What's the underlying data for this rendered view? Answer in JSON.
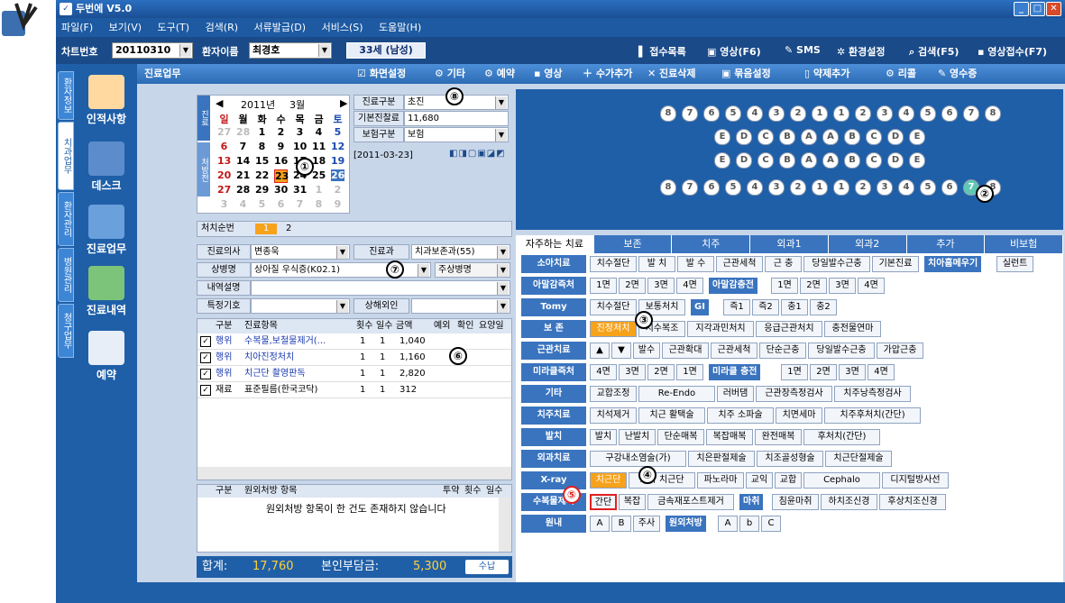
{
  "window": {
    "title": "두번에 V5.0"
  },
  "menu": [
    "파일(F)",
    "보기(V)",
    "도구(T)",
    "검색(R)",
    "서류발급(D)",
    "서비스(S)",
    "도움말(H)"
  ],
  "toolbar": {
    "chart_label": "차트번호",
    "chart_no": "20110310",
    "patient_label": "환자이름",
    "patient_name": "최경호",
    "age": "33세 (남성)",
    "right": [
      "접수목록",
      "영상(F6)",
      "SMS",
      "환경설정",
      "검색(F5)",
      "영상접수(F7)"
    ]
  },
  "nav": {
    "vtabs": [
      "환자정보",
      "치과업무",
      "환자관리",
      "병원관리",
      "청구업무"
    ],
    "items": [
      "인적사항",
      "데스크",
      "진료업무",
      "진료내역",
      "예약"
    ]
  },
  "main": {
    "title": "진료업무",
    "actions": [
      "화면설정",
      "기타",
      "예약",
      "영상",
      "수가추가",
      "진료삭제",
      "묶음설정",
      "약제추가",
      "리콜",
      "영수증"
    ]
  },
  "calendar": {
    "year": "2011년",
    "month": "3월",
    "weekdays": [
      "일",
      "월",
      "화",
      "수",
      "목",
      "금",
      "토"
    ],
    "rows": [
      [
        "27",
        "28",
        "1",
        "2",
        "3",
        "4",
        "5"
      ],
      [
        "6",
        "7",
        "8",
        "9",
        "10",
        "11",
        "12"
      ],
      [
        "13",
        "14",
        "15",
        "16",
        "17",
        "18",
        "19"
      ],
      [
        "20",
        "21",
        "22",
        "23",
        "24",
        "25",
        "26"
      ],
      [
        "27",
        "28",
        "29",
        "30",
        "31",
        "1",
        "2"
      ],
      [
        "3",
        "4",
        "5",
        "6",
        "7",
        "8",
        "9"
      ]
    ],
    "side1": "진료",
    "side2": "처방전"
  },
  "info": {
    "gubun_label": "진료구분",
    "gubun": "초진",
    "base_label": "기본진찰료",
    "base": "11,680",
    "ins_label": "보험구분",
    "ins": "보험",
    "date": "[2011-03-23]"
  },
  "order": {
    "label": "처치순번",
    "n1": "1",
    "n2": "2"
  },
  "form": {
    "doctor_label": "진료의사",
    "doctor": "변종욱",
    "dept_label": "진료과",
    "dept": "치과보존과(55)",
    "disease_label": "상병명",
    "disease": "상아질 우식증(K02.1)",
    "main_disease": "주상병명",
    "desc_label": "내역설명",
    "special_label": "특정기호",
    "sang_label": "상해외인"
  },
  "grid": {
    "headers": [
      "구분",
      "진료항목",
      "횟수",
      "일수",
      "금액",
      "예외",
      "확인",
      "요양일"
    ],
    "rows": [
      {
        "type": "행위",
        "item": "수복물,보철물제거(...",
        "cnt": "1",
        "days": "1",
        "amt": "1,040"
      },
      {
        "type": "행위",
        "item": "치아진정처치",
        "cnt": "1",
        "days": "1",
        "amt": "1,160"
      },
      {
        "type": "행위",
        "item": "치근단 촬영판독",
        "cnt": "1",
        "days": "1",
        "amt": "2,820"
      },
      {
        "type": "재료",
        "item": "표준필름(한국코닥)",
        "cnt": "1",
        "days": "1",
        "amt": "312"
      }
    ]
  },
  "rx": {
    "headers": [
      "구분",
      "원외처방 항목",
      "투약",
      "횟수",
      "일수"
    ],
    "empty": "원외처방 항목이 한 건도 존재하지 않습니다"
  },
  "totals": {
    "sum_label": "합계:",
    "sum": "17,760",
    "self_label": "본인부담금:",
    "self": "5,300",
    "pay": "수납"
  },
  "teeth": {
    "upper_perm": [
      "8",
      "7",
      "6",
      "5",
      "4",
      "3",
      "2",
      "1",
      "1",
      "2",
      "3",
      "4",
      "5",
      "6",
      "7",
      "8"
    ],
    "upper_prim": [
      "E",
      "D",
      "C",
      "B",
      "A",
      "A",
      "B",
      "C",
      "D",
      "E"
    ],
    "lower_prim": [
      "E",
      "D",
      "C",
      "B",
      "A",
      "A",
      "B",
      "C",
      "D",
      "E"
    ],
    "lower_perm": [
      "8",
      "7",
      "6",
      "5",
      "4",
      "3",
      "2",
      "1",
      "1",
      "2",
      "3",
      "4",
      "5",
      "6",
      "7",
      "8"
    ]
  },
  "tabs": [
    "자주하는 치료",
    "보존",
    "치주",
    "외과1",
    "외과2",
    "추가",
    "비보험"
  ],
  "treatments": [
    {
      "cat": "소아치료",
      "items": [
        "치수절단",
        "발 치",
        "발 수",
        "근관세척",
        "근 충",
        "당일발수근충",
        "기본진료"
      ],
      "sub": "치아홈메우기",
      "sub_items": [
        "실런트"
      ]
    },
    {
      "cat": "아말감즉처",
      "items": [
        "1면",
        "2면",
        "3면",
        "4면"
      ],
      "sub": "아말감충전",
      "sub_items": [
        "1면",
        "2면",
        "3면",
        "4면"
      ]
    },
    {
      "cat": "Tomy",
      "items": [
        "치수절단",
        "보통처치"
      ],
      "sub": "GI",
      "sub_items": [
        "즉1",
        "즉2",
        "충1",
        "충2"
      ]
    },
    {
      "cat": "보 존",
      "items": [
        "진정처치",
        "치수복조",
        "지각과민처치",
        "응급근관처치",
        "충전물연마"
      ]
    },
    {
      "cat": "근관치료",
      "items": [
        "▲",
        "▼",
        "발수",
        "근관확대",
        "근관세척",
        "단순근충",
        "당일발수근충",
        "가압근충"
      ]
    },
    {
      "cat": "미라클즉처",
      "items": [
        "4면",
        "3면",
        "2면",
        "1면"
      ],
      "sub": "미라클 충전",
      "sub_items": [
        "1면",
        "2면",
        "3면",
        "4면"
      ]
    },
    {
      "cat": "기타",
      "items": [
        "교합조정",
        "Re-Endo",
        "러버댐",
        "근관장측정검사",
        "치주낭측정검사"
      ]
    },
    {
      "cat": "치주치료",
      "items": [
        "치석제거",
        "치근 활택술",
        "치주 소파술",
        "치면세마",
        "치주후처치(간단)"
      ]
    },
    {
      "cat": "발치",
      "items": [
        "발치",
        "난발치",
        "단순매복",
        "복잡매복",
        "완전매복",
        "후처치(간단)"
      ]
    },
    {
      "cat": "외과치료",
      "items": [
        "구강내소염술(가)",
        "치은판절제술",
        "치조골성형술",
        "치근단절제술"
      ]
    },
    {
      "cat": "X-ray",
      "items": [
        "치근단",
        "교아 치근단",
        "파노라마",
        "교익",
        "교합",
        "Cephalo",
        "디지털방사선"
      ]
    },
    {
      "cat": "수복물제거",
      "items": [
        "간단",
        "복잡",
        "금속재포스트제거"
      ],
      "sub": "마취",
      "sub_items": [
        "침윤마취",
        "하치조신경",
        "후상치조신경"
      ]
    },
    {
      "cat": "원내",
      "items": [
        "A",
        "B",
        "주사"
      ],
      "sub": "원외처방",
      "sub_items": [
        "A",
        "b",
        "C"
      ]
    }
  ],
  "markers": [
    "①",
    "②",
    "③",
    "④",
    "⑤",
    "⑥",
    "⑦",
    "⑧"
  ],
  "colors": {
    "accent": "#f7a21b",
    "nav": "#1f5fa8",
    "highlight": "#e02020"
  }
}
